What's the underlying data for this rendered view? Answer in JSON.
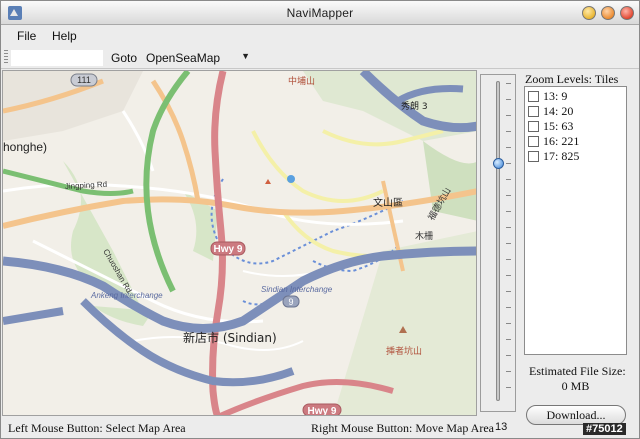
{
  "window": {
    "title": "NaviMapper"
  },
  "menu": {
    "file": "File",
    "help": "Help"
  },
  "toolbar": {
    "search_value": "",
    "goto_label": "Goto",
    "goto_selected": "OpenSeaMap"
  },
  "map": {
    "labels": {
      "zhonghe": "honghe)",
      "jingping": "Jingping Rd",
      "hwy9_a": "Hwy 9",
      "hwy9_b": "Hwy 9",
      "anfeng": "Ankeng Interchange",
      "sindian_ic": "Sindian Interchange",
      "sindian": "新店市 (Sindian)",
      "road111": "111",
      "road9": "9",
      "wenshan": "文山區",
      "chuoshan": "Chuoshan Rd",
      "muzha": "木柵",
      "shengshan": "挿者坑山",
      "fuji": "福德坑山",
      "zhongshan": "中埔山",
      "hsiu": "秀朗 3"
    }
  },
  "slider": {
    "value": "13"
  },
  "zoom_panel": {
    "title": "Zoom Levels: Tiles",
    "levels": [
      {
        "label": "13: 9",
        "checked": false
      },
      {
        "label": "14: 20",
        "checked": false
      },
      {
        "label": "15: 63",
        "checked": false
      },
      {
        "label": "16: 221",
        "checked": false
      },
      {
        "label": "17: 825",
        "checked": false
      }
    ]
  },
  "estimate": {
    "label": "Estimated File Size:",
    "value": "0 MB"
  },
  "download_label": "Download...",
  "status": {
    "left": "Left Mouse Button: Select Map Area",
    "right": "Right Mouse Button: Move Map Area"
  },
  "watermark": "#75012"
}
